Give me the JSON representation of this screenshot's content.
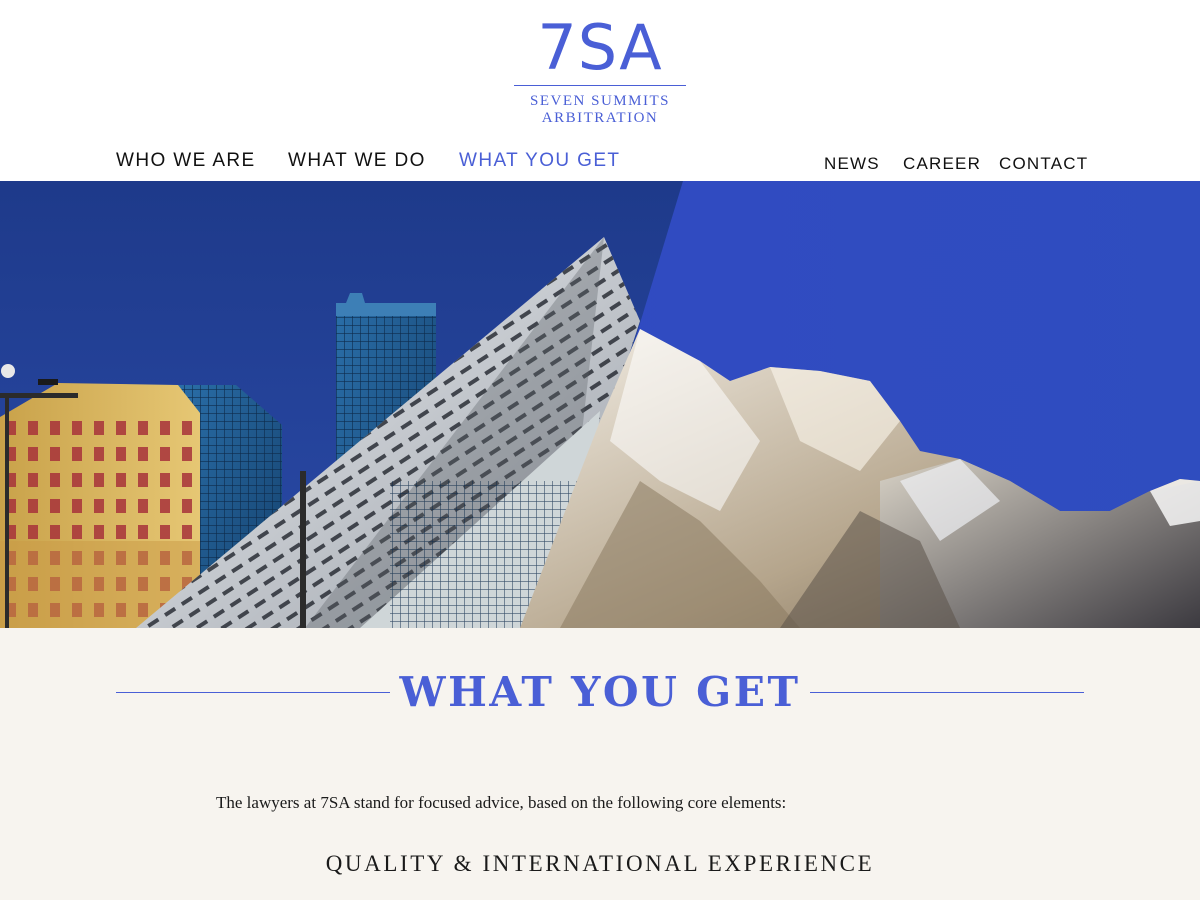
{
  "logo": {
    "mark": "7SA",
    "line1": "SEVEN SUMMITS",
    "line2": "ARBITRATION"
  },
  "nav": {
    "main": [
      {
        "label": "WHO WE ARE"
      },
      {
        "label": "WHAT WE DO"
      },
      {
        "label": "WHAT YOU GET",
        "active": true
      }
    ],
    "side": [
      {
        "label": "NEWS"
      },
      {
        "label": "CAREER"
      },
      {
        "label": "CONTACT"
      }
    ]
  },
  "hero": {
    "image": "city-architecture-and-mountain-peak-collage"
  },
  "content": {
    "heading": "WHAT YOU GET",
    "intro": "The lawyers at 7SA stand for focused advice, based on the following core elements:",
    "subheading": "QUALITY & INTERNATIONAL EXPERIENCE"
  },
  "colors": {
    "brand": "#4a5fd6",
    "content_background": "#f7f4ef",
    "text": "#111111"
  }
}
